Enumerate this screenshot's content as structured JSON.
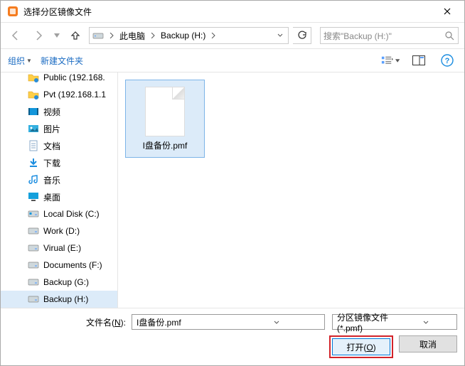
{
  "title": "选择分区镜像文件",
  "breadcrumb": {
    "seg1": "此电脑",
    "seg2": "Backup (H:)"
  },
  "search": {
    "placeholder": "搜索\"Backup (H:)\""
  },
  "toolbar": {
    "organize": "组织",
    "newfolder": "新建文件夹"
  },
  "tree": [
    {
      "label": "Public (192.168.",
      "icon": "folder-net"
    },
    {
      "label": "Pvt (192.168.1.1",
      "icon": "folder-net"
    },
    {
      "label": "视频",
      "icon": "video"
    },
    {
      "label": "图片",
      "icon": "pictures"
    },
    {
      "label": "文档",
      "icon": "documents"
    },
    {
      "label": "下载",
      "icon": "downloads"
    },
    {
      "label": "音乐",
      "icon": "music"
    },
    {
      "label": "桌面",
      "icon": "desktop"
    },
    {
      "label": "Local Disk (C:)",
      "icon": "drive-os"
    },
    {
      "label": "Work (D:)",
      "icon": "drive"
    },
    {
      "label": "Virual (E:)",
      "icon": "drive"
    },
    {
      "label": "Documents (F:)",
      "icon": "drive"
    },
    {
      "label": "Backup (G:)",
      "icon": "drive"
    },
    {
      "label": "Backup (H:)",
      "icon": "drive",
      "selected": true
    }
  ],
  "files": [
    {
      "label": "I盘备份.pmf",
      "selected": true
    }
  ],
  "footer": {
    "filename_label_pre": "文件名(",
    "filename_label_u": "N",
    "filename_label_post": "):",
    "filename_value": "I盘备份.pmf",
    "filter": "分区镜像文件(*.pmf)",
    "open_pre": "打开(",
    "open_u": "O",
    "open_post": ")",
    "cancel": "取消"
  }
}
